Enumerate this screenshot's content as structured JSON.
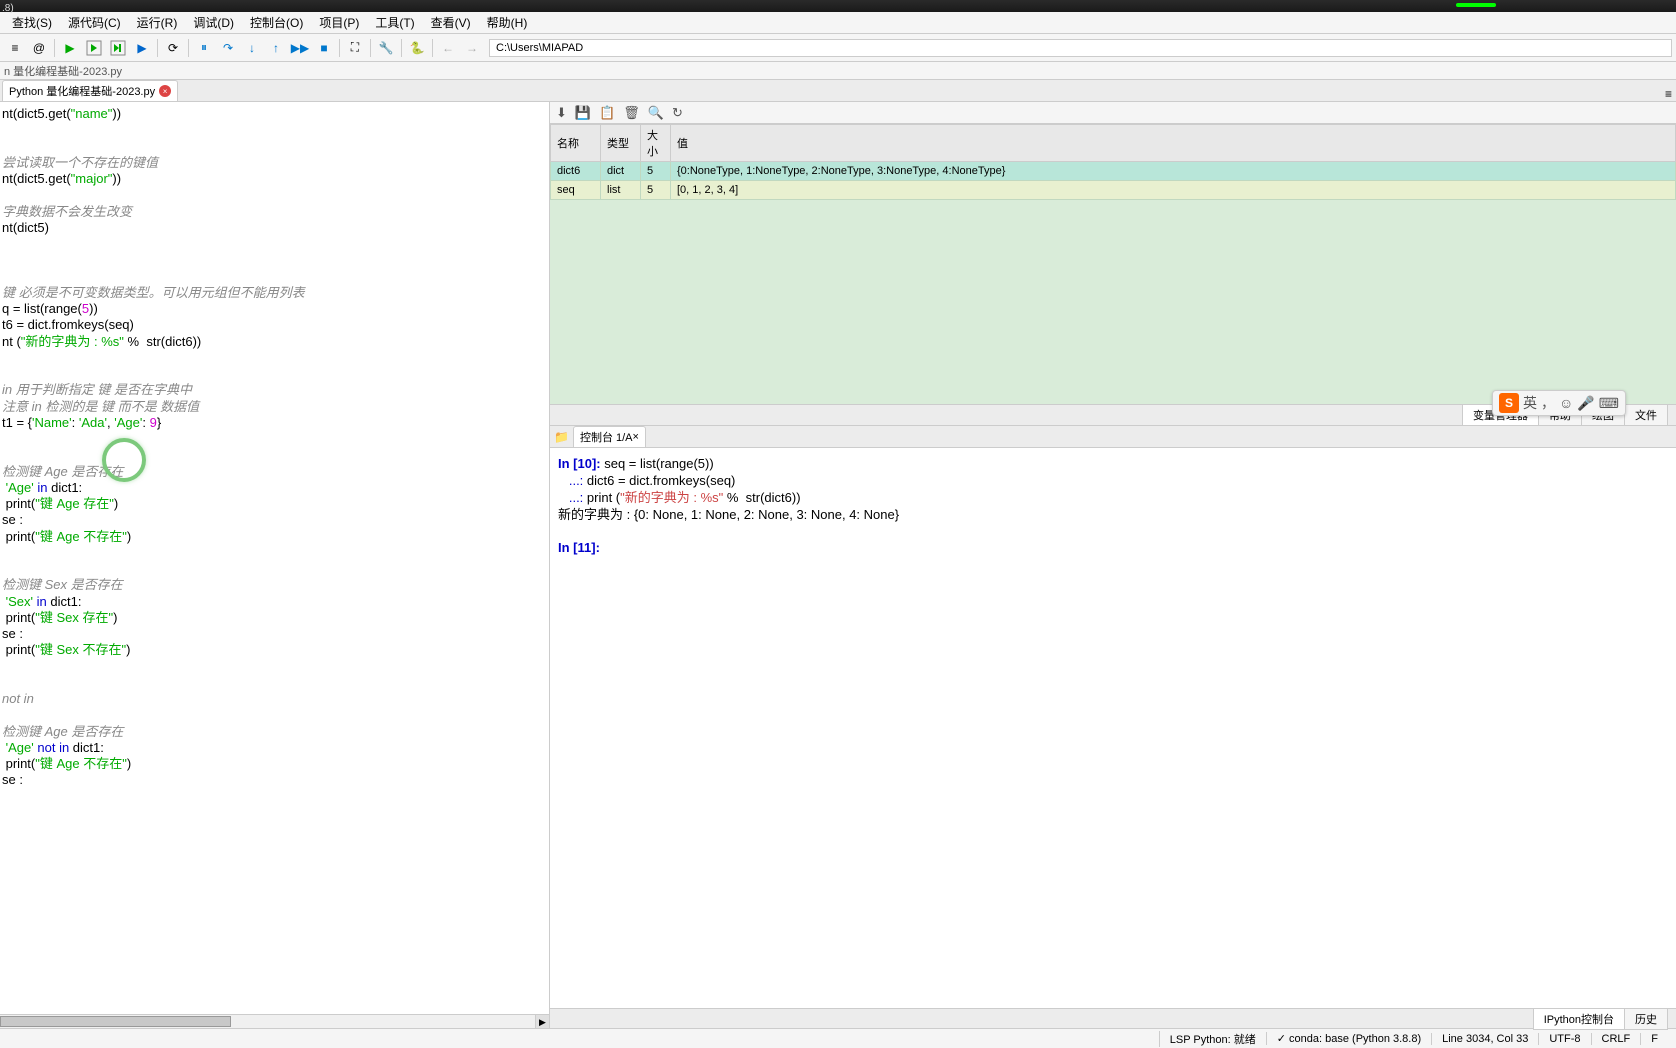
{
  "title_suffix": ".8)",
  "menu": [
    "查找(S)",
    "源代码(C)",
    "运行(R)",
    "调试(D)",
    "控制台(O)",
    "项目(P)",
    "工具(T)",
    "查看(V)",
    "帮助(H)"
  ],
  "toolbar_path": "C:\\Users\\MIAPAD",
  "breadcrumb": "n 量化编程基础-2023.py",
  "editor_tab": "Python 量化编程基础-2023.py",
  "code_lines": [
    {
      "t": "code",
      "html": "<span class='fn'>nt</span>(dict5.get(<span class='str'>\"name\"</span>))"
    },
    {
      "t": "blank"
    },
    {
      "t": "blank"
    },
    {
      "t": "comment",
      "text": "尝试读取一个不存在的键值"
    },
    {
      "t": "code",
      "html": "<span class='fn'>nt</span>(dict5.get(<span class='str'>\"major\"</span>))"
    },
    {
      "t": "blank"
    },
    {
      "t": "comment",
      "text": "字典数据不会发生改变"
    },
    {
      "t": "code",
      "html": "<span class='fn'>nt</span>(dict5)"
    },
    {
      "t": "blank"
    },
    {
      "t": "blank"
    },
    {
      "t": "blank"
    },
    {
      "t": "comment",
      "text": "键 必须是不可变数据类型。可以用元组但不能用列表"
    },
    {
      "t": "code",
      "html": "q = <span class='fn'>list</span>(<span class='fn'>range</span>(<span class='num'>5</span>))"
    },
    {
      "t": "code",
      "html": "t6 = <span class='fn'>dict</span>.fromkeys(seq)"
    },
    {
      "t": "code",
      "html": "<span class='fn'>nt</span> (<span class='str'>\"新的字典为 : %s\"</span> %  <span class='fn'>str</span>(dict6))"
    },
    {
      "t": "blank"
    },
    {
      "t": "blank"
    },
    {
      "t": "comment",
      "text": "in 用于判断指定 键 是否在字典中"
    },
    {
      "t": "comment",
      "text": "注意 in 检测的是 键 而不是 数据值"
    },
    {
      "t": "code",
      "html": "t1 = {<span class='str'>'Name'</span>: <span class='str'>'Ada'</span>, <span class='str'>'Age'</span>: <span class='num'>9</span>}"
    },
    {
      "t": "blank"
    },
    {
      "t": "blank"
    },
    {
      "t": "comment",
      "text": "检测键 Age 是否存在"
    },
    {
      "t": "code",
      "html": " <span class='str'>'Age'</span> <span class='kw'>in</span> dict1:"
    },
    {
      "t": "code",
      "html": " <span class='fn'>print</span>(<span class='str'>\"键 Age 存在\"</span>)"
    },
    {
      "t": "code",
      "html": "se :"
    },
    {
      "t": "code",
      "html": " <span class='fn'>print</span>(<span class='str'>\"键 Age 不存在\"</span>)"
    },
    {
      "t": "blank"
    },
    {
      "t": "blank"
    },
    {
      "t": "comment",
      "text": "检测键 Sex 是否存在"
    },
    {
      "t": "code",
      "html": " <span class='str'>'Sex'</span> <span class='kw'>in</span> dict1:"
    },
    {
      "t": "code",
      "html": " <span class='fn'>print</span>(<span class='str'>\"键 Sex 存在\"</span>)"
    },
    {
      "t": "code",
      "html": "se :"
    },
    {
      "t": "code",
      "html": " <span class='fn'>print</span>(<span class='str'>\"键 Sex 不存在\"</span>)"
    },
    {
      "t": "blank"
    },
    {
      "t": "blank"
    },
    {
      "t": "comment",
      "text": "not in"
    },
    {
      "t": "blank"
    },
    {
      "t": "comment",
      "text": "检测键 Age 是否存在"
    },
    {
      "t": "code",
      "html": " <span class='str'>'Age'</span> <span class='kw'>not</span> <span class='kw'>in</span> dict1:"
    },
    {
      "t": "code",
      "html": " <span class='fn'>print</span>(<span class='str'>\"键 Age 不存在\"</span>)"
    },
    {
      "t": "code",
      "html": "se :"
    }
  ],
  "var_headers": [
    "名称",
    "类型",
    "大小",
    "值"
  ],
  "var_rows": [
    {
      "name": "dict6",
      "type": "dict",
      "size": "5",
      "value": "{0:NoneType, 1:NoneType, 2:NoneType, 3:NoneType, 4:NoneType}",
      "cls": "row-highlight"
    },
    {
      "name": "seq",
      "type": "list",
      "size": "5",
      "value": "[0, 1, 2, 3, 4]",
      "cls": "row-normal"
    }
  ],
  "pane_tabs": [
    "变量管理器",
    "帮助",
    "绘图",
    "文件"
  ],
  "console_tab": "控制台 1/A",
  "console_lines": [
    {
      "type": "in",
      "n": "10",
      "text": "seq = list(range(5))"
    },
    {
      "type": "cont",
      "text": "dict6 = dict.fromkeys(seq)"
    },
    {
      "type": "cont_print",
      "prefix": "print (",
      "str": "\"新的字典为 : %s\"",
      "suffix": " %  str(dict6))"
    },
    {
      "type": "out",
      "text": "新的字典为 : {0: None, 1: None, 2: None, 3: None, 4: None}"
    },
    {
      "type": "blank"
    },
    {
      "type": "in",
      "n": "11",
      "text": ""
    }
  ],
  "bottom_tabs": [
    "IPython控制台",
    "历史"
  ],
  "status": {
    "lsp": "LSP Python: 就绪",
    "conda": "✓ conda: base (Python 3.8.8)",
    "pos": "Line 3034, Col 33",
    "enc": "UTF-8",
    "eol": "CRLF",
    "last": "F"
  },
  "ime": {
    "brand": "S",
    "lang": "英",
    "dot": "，",
    "emoji": "☺",
    "mic": "🎤",
    "kbd": "⌨"
  }
}
